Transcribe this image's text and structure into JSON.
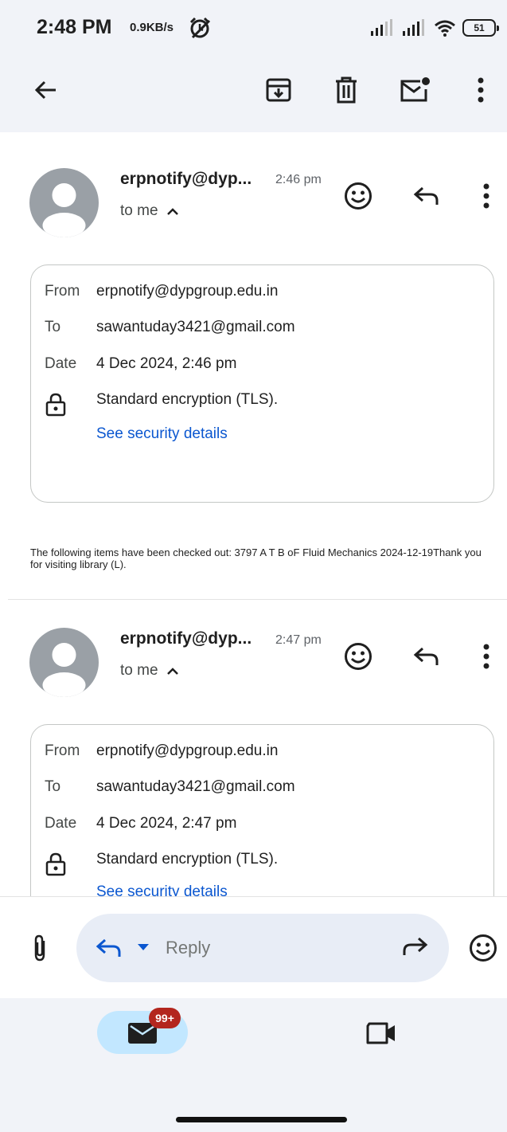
{
  "status_bar": {
    "time": "2:48 PM",
    "speed": "0.9KB/s",
    "battery": "51"
  },
  "toolbar": {
    "back_icon": "arrow-left-icon",
    "archive_icon": "archive-icon",
    "delete_icon": "trash-icon",
    "mark_unread_icon": "mail-unread-icon",
    "more_icon": "more-vert-icon"
  },
  "messages": [
    {
      "sender": "erpnotify@dyp...",
      "time": "2:46 pm",
      "to_me": "to me",
      "details": {
        "from_label": "From",
        "from": "erpnotify@dypgroup.edu.in",
        "to_label": "To",
        "to": "sawantuday3421@gmail.com",
        "date_label": "Date",
        "date": "4 Dec 2024, 2:46 pm",
        "encryption": "Standard encryption (TLS).",
        "security_link": "See security details"
      },
      "body": "The following items have been checked out: 3797 A T B oF Fluid Mechanics 2024-12-19Thank you for visiting library (L)."
    },
    {
      "sender": "erpnotify@dyp...",
      "time": "2:47 pm",
      "to_me": "to me",
      "details": {
        "from_label": "From",
        "from": "erpnotify@dypgroup.edu.in",
        "to_label": "To",
        "to": "sawantuday3421@gmail.com",
        "date_label": "Date",
        "date": "4 Dec 2024, 2:47 pm",
        "encryption": "Standard encryption (TLS).",
        "security_link": "See security details"
      }
    }
  ],
  "reply_bar": {
    "placeholder": "Reply"
  },
  "bottom_nav": {
    "mail_badge": "99+"
  },
  "colors": {
    "accent_blue": "#0b57d0",
    "surface": "#f1f3f8",
    "badge_red": "#b3261e",
    "nav_active": "#c2e7ff"
  }
}
